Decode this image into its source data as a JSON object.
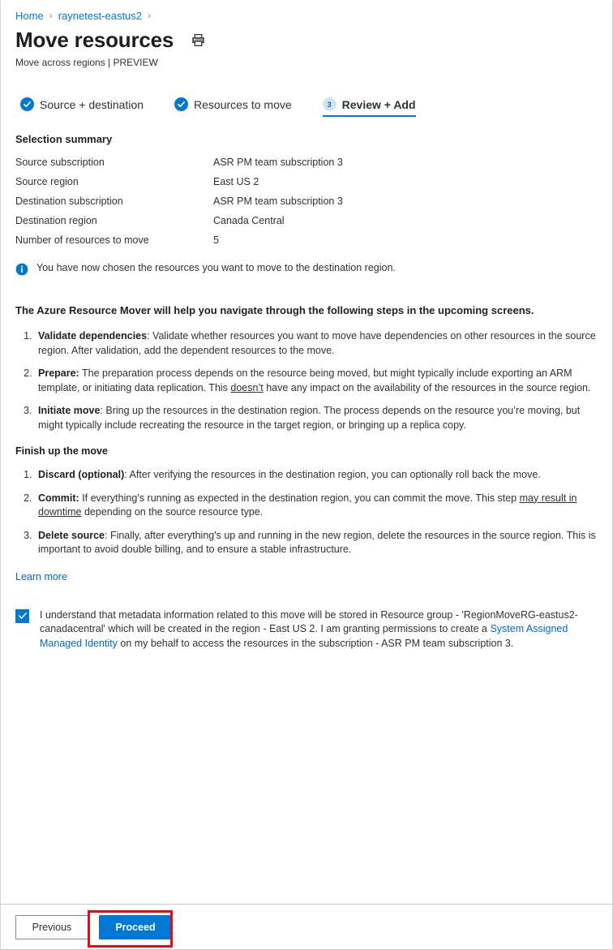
{
  "breadcrumb": {
    "items": [
      {
        "label": "Home"
      },
      {
        "label": "raynetest-eastus2"
      }
    ],
    "separator": "›"
  },
  "header": {
    "title": "Move resources",
    "subtitle": "Move across regions | PREVIEW",
    "print_icon": "print-icon"
  },
  "tabs": [
    {
      "label": "Source + destination",
      "state": "complete",
      "icon": "check-circle-icon"
    },
    {
      "label": "Resources to move",
      "state": "complete",
      "icon": "check-circle-icon"
    },
    {
      "label": "Review + Add",
      "state": "active",
      "number": "3"
    }
  ],
  "summary": {
    "heading": "Selection summary",
    "rows": [
      {
        "label": "Source subscription",
        "value": "ASR PM team subscription 3"
      },
      {
        "label": "Source region",
        "value": "East US 2"
      },
      {
        "label": "Destination subscription",
        "value": "ASR PM team subscription 3"
      },
      {
        "label": "Destination region",
        "value": "Canada Central"
      },
      {
        "label": "Number of resources to move",
        "value": "5"
      }
    ]
  },
  "info": {
    "icon": "info-icon",
    "text": "You have now chosen the resources you want to move to the destination region."
  },
  "body": {
    "lead": "The Azure Resource Mover will help you navigate through the following steps in the upcoming screens.",
    "steps": [
      {
        "term": "Validate dependencies",
        "term_suffix": ":",
        "text": " Validate whether resources you want to move have dependencies on other resources in the source region. After validation, add the dependent resources to the move."
      },
      {
        "term": "Prepare:",
        "text_before": " The preparation process depends on the resource being moved, but might typically include exporting an ARM template, or initiating data replication. This ",
        "underlined": "doesn’t",
        "text_after": " have any impact on the availability of the resources in the source region."
      },
      {
        "term": "Initiate move",
        "term_suffix": ":",
        "text": " Bring up the resources in the destination region. The process depends on the resource you’re moving, but might typically include recreating the resource in the target region, or bringing up a replica copy."
      }
    ],
    "finish_heading": "Finish up the move",
    "finish_steps": [
      {
        "term": "Discard (optional)",
        "term_suffix": ":",
        "text": " After verifying the resources in the destination region, you can optionally roll back the move."
      },
      {
        "term": "Commit:",
        "text_before": " If everything’s running as expected in the destination region, you can commit the move. This step ",
        "underlined": "may result in downtime",
        "text_after": " depending on the source resource type."
      },
      {
        "term": "Delete source",
        "term_suffix": ":",
        "text": " Finally, after everything's up and running in the new region, delete the resources in the source region. This is important to avoid double billing, and to ensure a stable infrastructure."
      }
    ],
    "learn_more": "Learn more"
  },
  "consent": {
    "checked": true,
    "text_1": "I understand that metadata information related to this move will be stored in Resource group - 'RegionMoveRG-eastus2-canadacentral' which will be created in the region - East US 2. I am granting permissions to create a ",
    "link": "System Assigned Managed Identity",
    "text_2": " on my behalf to access the resources in the subscription - ASR PM team subscription 3."
  },
  "footer": {
    "previous_label": "Previous",
    "proceed_label": "Proceed",
    "highlight_color": "#e00b1c"
  },
  "colors": {
    "accent": "#0078d4",
    "link": "#0066cc",
    "text": "#323130",
    "highlight": "#e00b1c"
  }
}
